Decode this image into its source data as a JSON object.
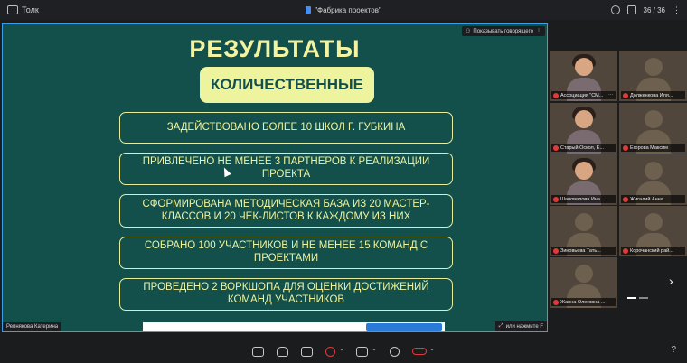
{
  "app": {
    "name": "Толк",
    "meeting_title": "\"Фабрика проектов\"",
    "participants_count": "36 / 36"
  },
  "share": {
    "show_speaker_label": "Показывать говорящего",
    "presenter_name": "Репнякова Катерина",
    "fullscreen_hint": "или нажмите F"
  },
  "slide": {
    "title": "РЕЗУЛЬТАТЫ",
    "subtitle": "КОЛИЧЕСТВЕННЫЕ",
    "items": [
      "ЗАДЕЙСТВОВАНО БОЛЕЕ 10 ШКОЛ Г. ГУБКИНА",
      "ПРИВЛЕЧЕНО НЕ МЕНЕЕ 3 ПАРТНЕРОВ К РЕАЛИЗАЦИИ ПРОЕКТА",
      "СФОРМИРОВАНА МЕТОДИЧЕСКАЯ БАЗА ИЗ 20 МАСТЕР-КЛАССОВ И 20 ЧЕК-ЛИСТОВ К КАЖДОМУ ИЗ НИХ",
      "СОБРАНО 100 УЧАСТНИКОВ И НЕ МЕНЕЕ 15 КОМАНД С ПРОЕКТАМИ",
      "ПРОВЕДЕНО 2 ВОРКШОПА ДЛЯ ОЦЕНКИ ДОСТИЖЕНИЙ КОМАНД УЧАСТНИКОВ"
    ]
  },
  "participants": [
    {
      "name": "Ассоциация \"СМ...",
      "photo": true
    },
    {
      "name": "Долженкова Иля...",
      "photo": false
    },
    {
      "name": "Старый Оскол, Е...",
      "photo": true
    },
    {
      "name": "Егорова Максим",
      "photo": false
    },
    {
      "name": "Шаповалова Ина...",
      "photo": true
    },
    {
      "name": "Жигалий Анна",
      "photo": false
    },
    {
      "name": "Зиновьева Тать...",
      "photo": false
    },
    {
      "name": "Корочанский рай...",
      "photo": false
    },
    {
      "name": "Жанна Олеговна ...",
      "photo": false
    }
  ],
  "colors": {
    "slide_bg": "#134f4b",
    "slide_accent": "#eef39e",
    "active_border": "#3aa0e8",
    "mute_red": "#e23a3a"
  },
  "icons": [
    "window-icon",
    "doc-icon",
    "smile-icon",
    "participants-icon",
    "more-icon",
    "chat-icon",
    "raise-hand-icon",
    "screen-share-icon",
    "mic-muted-icon",
    "camera-icon",
    "record-icon",
    "end-call-icon",
    "help-icon",
    "next-page-icon"
  ],
  "bottombar": {
    "help": "?"
  }
}
